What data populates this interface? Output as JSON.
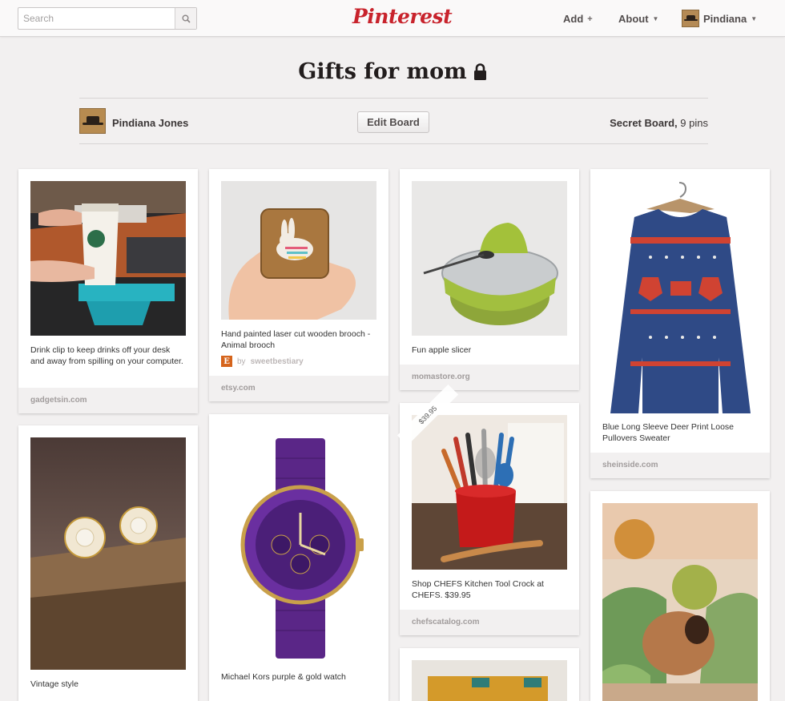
{
  "header": {
    "search_placeholder": "Search",
    "logo_text": "Pinterest",
    "nav": {
      "add_label": "Add",
      "about_label": "About",
      "user_label": "Pindiana"
    }
  },
  "board": {
    "title": "Gifts for mom",
    "owner_name": "Pindiana Jones",
    "edit_button": "Edit Board",
    "secret_label": "Secret Board,",
    "pin_count": "9 pins"
  },
  "pins": [
    {
      "description": "Drink clip to keep drinks off your desk and away from spilling on your computer.",
      "source": "gadgetsin.com"
    },
    {
      "description": "Hand painted laser cut wooden brooch - Animal brooch",
      "via_prefix": "by",
      "via_name": "sweetbestiary",
      "source": "etsy.com"
    },
    {
      "description": "Fun apple slicer",
      "source": "momastore.org"
    },
    {
      "description": "Blue Long Sleeve Deer Print Loose Pullovers Sweater",
      "source": "sheinside.com"
    },
    {
      "description": "Vintage style"
    },
    {
      "description": "Michael Kors purple & gold watch"
    },
    {
      "price": "$39.95",
      "description": "Shop CHEFS Kitchen Tool Crock at CHEFS. $39.95",
      "source": "chefscatalog.com"
    }
  ],
  "colors": {
    "brand_red": "#c8232c",
    "page_bg": "#f2f0f0"
  }
}
